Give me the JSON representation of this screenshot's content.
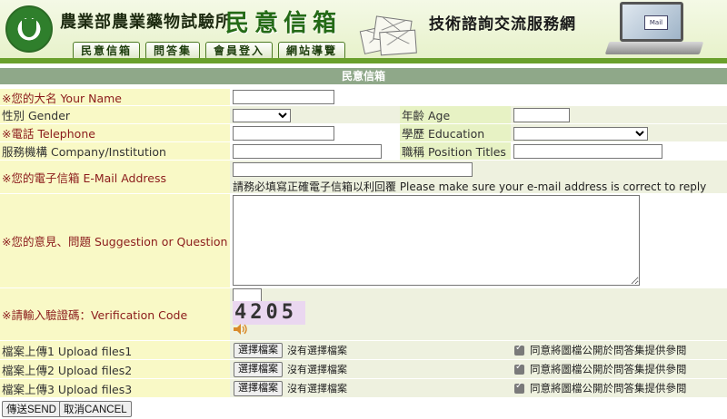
{
  "header": {
    "institution": "農業部農業藥物試驗所",
    "mailbox_title": "民意信箱",
    "service_title": "技術諮詢交流服務網",
    "laptop_mail_label": "Mail"
  },
  "nav": {
    "items": [
      {
        "label": "民意信箱"
      },
      {
        "label": "問答集"
      },
      {
        "label": "會員登入"
      },
      {
        "label": "網站導覽"
      }
    ]
  },
  "form": {
    "title": "民意信箱",
    "name_label": "※您的大名 Your Name",
    "gender_label": "性別 Gender",
    "age_label": "年齡 Age",
    "phone_label": "※電話 Telephone",
    "education_label": "學歷 Education",
    "company_label": "服務機構 Company/Institution",
    "position_label": "職稱 Position Titles",
    "email_label": "※您的電子信箱 E-Mail Address",
    "email_hint": "請務必填寫正確電子信箱以利回覆 Please make sure your e-mail address is correct to reply",
    "suggestion_label": "※您的意見、問題 Suggestion or Question",
    "verify_label": "※請輸入驗證碼：Verification Code",
    "captcha_text": "4205",
    "uploads": [
      {
        "label": "檔案上傳1 Upload files1",
        "button": "選擇檔案",
        "status": "沒有選擇檔案",
        "consent": "同意將圖檔公開於問答集提供參閱"
      },
      {
        "label": "檔案上傳2 Upload files2",
        "button": "選擇檔案",
        "status": "沒有選擇檔案",
        "consent": "同意將圖檔公開於問答集提供參閱"
      },
      {
        "label": "檔案上傳3 Upload files3",
        "button": "選擇檔案",
        "status": "沒有選擇檔案",
        "consent": "同意將圖檔公開於問答集提供參閱"
      }
    ],
    "send_label": "傳送SEND",
    "cancel_label": "取消CANCEL"
  },
  "colors": {
    "header_green": "#246a16",
    "label_bg": "#f9f9c6",
    "value_bg": "#eef1df",
    "title_bar": "#8fa889",
    "required_text": "#8b1b1b"
  }
}
